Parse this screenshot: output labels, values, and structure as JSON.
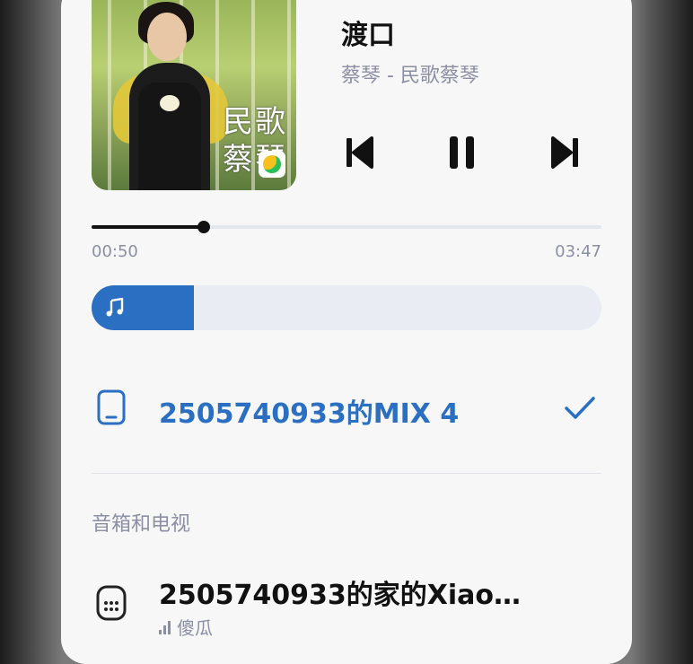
{
  "now_playing": {
    "title": "渡口",
    "subtitle": "蔡琴 - 民歌蔡琴",
    "album_art_text": [
      "民歌",
      "蔡琴"
    ]
  },
  "progress": {
    "current": "00:50",
    "total": "03:47",
    "fraction": 0.22
  },
  "volume": {
    "fraction": 0.2
  },
  "devices": {
    "current": {
      "name": "2505740933的MIX 4",
      "selected": true
    },
    "section_label": "音箱和电视",
    "speaker": {
      "name": "2505740933的家的Xiao…",
      "sub": "傻瓜"
    }
  },
  "colors": {
    "accent": "#2a6fc1",
    "muted": "#8a8fa3",
    "text": "#111111"
  },
  "icons": [
    "previous-icon",
    "pause-icon",
    "next-icon",
    "music-note-icon",
    "phone-icon",
    "check-icon",
    "speaker-icon",
    "signal-bars-icon"
  ]
}
